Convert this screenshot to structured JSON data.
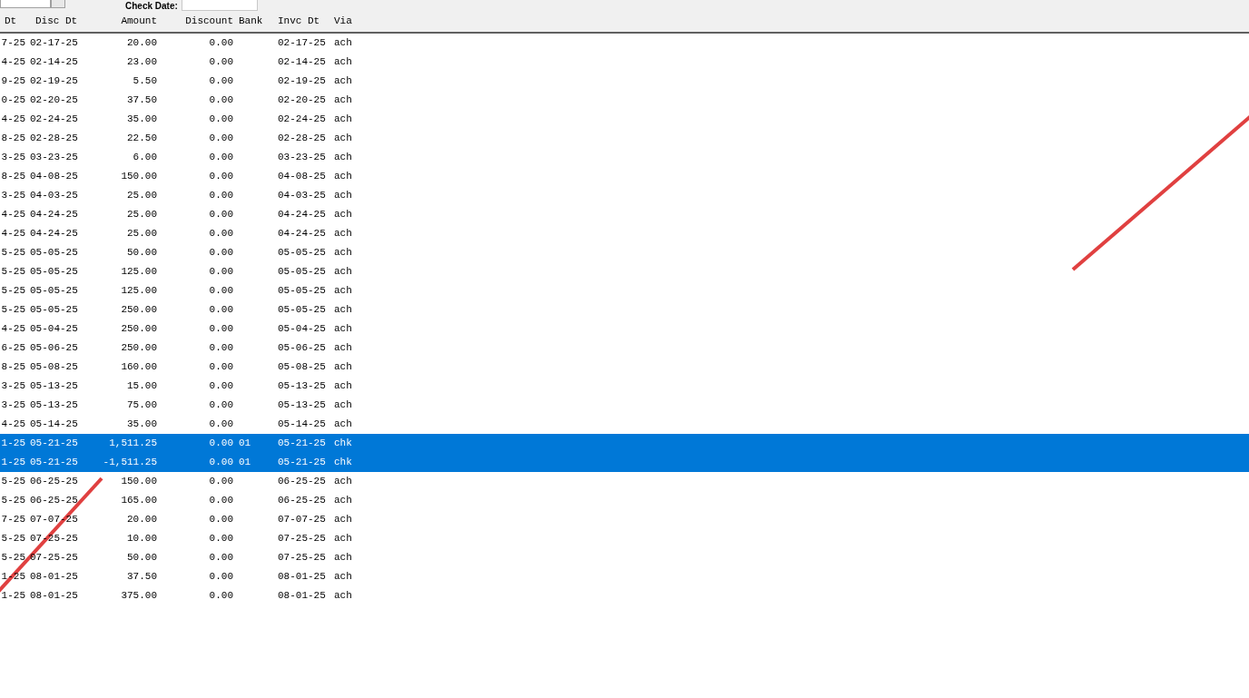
{
  "filter_bar": {
    "check_date_label": "Check Date:"
  },
  "table": {
    "columns": [
      "Dt",
      "Disc Dt",
      "Amount",
      "Discount",
      "Bank",
      "Invc Dt",
      "Via"
    ],
    "rows": [
      {
        "column_1": "7-25",
        "disc_dt": "02-17-25",
        "amount": "20.00",
        "discount": "0.00",
        "invc_dt": "02-17-25",
        "via": "ach",
        "selected": false
      },
      {
        "column_1": "4-25",
        "disc_dt": "02-14-25",
        "amount": "23.00",
        "discount": "0.00",
        "invc_dt": "02-14-25",
        "via": "ach",
        "selected": false
      },
      {
        "column_1": "9-25",
        "disc_dt": "02-19-25",
        "amount": "5.50",
        "discount": "0.00",
        "invc_dt": "02-19-25",
        "via": "ach",
        "selected": false
      },
      {
        "column_1": "0-25",
        "disc_dt": "02-20-25",
        "amount": "37.50",
        "discount": "0.00",
        "invc_dt": "02-20-25",
        "via": "ach",
        "selected": false
      },
      {
        "column_1": "4-25",
        "disc_dt": "02-24-25",
        "amount": "35.00",
        "discount": "0.00",
        "invc_dt": "02-24-25",
        "via": "ach",
        "selected": false
      },
      {
        "column_1": "8-25",
        "disc_dt": "02-28-25",
        "amount": "22.50",
        "discount": "0.00",
        "invc_dt": "02-28-25",
        "via": "ach",
        "selected": false
      },
      {
        "column_1": "3-25",
        "disc_dt": "03-23-25",
        "amount": "6.00",
        "discount": "0.00",
        "invc_dt": "03-23-25",
        "via": "ach",
        "selected": false
      },
      {
        "column_1": "8-25",
        "disc_dt": "04-08-25",
        "amount": "150.00",
        "discount": "0.00",
        "invc_dt": "04-08-25",
        "via": "ach",
        "selected": false
      },
      {
        "column_1": "3-25",
        "disc_dt": "04-03-25",
        "amount": "25.00",
        "discount": "0.00",
        "invc_dt": "04-03-25",
        "via": "ach",
        "selected": false
      },
      {
        "column_1": "4-25",
        "disc_dt": "04-24-25",
        "amount": "25.00",
        "discount": "0.00",
        "invc_dt": "04-24-25",
        "via": "ach",
        "selected": false
      },
      {
        "column_1": "4-25",
        "disc_dt": "04-24-25",
        "amount": "25.00",
        "discount": "0.00",
        "invc_dt": "04-24-25",
        "via": "ach",
        "selected": false
      },
      {
        "column_1": "5-25",
        "disc_dt": "05-05-25",
        "amount": "50.00",
        "discount": "0.00",
        "invc_dt": "05-05-25",
        "via": "ach",
        "selected": false
      },
      {
        "column_1": "5-25",
        "disc_dt": "05-05-25",
        "amount": "125.00",
        "discount": "0.00",
        "invc_dt": "05-05-25",
        "via": "ach",
        "selected": false
      },
      {
        "column_1": "5-25",
        "disc_dt": "05-05-25",
        "amount": "125.00",
        "discount": "0.00",
        "invc_dt": "05-05-25",
        "via": "ach",
        "selected": false
      },
      {
        "column_1": "5-25",
        "disc_dt": "05-05-25",
        "amount": "250.00",
        "discount": "0.00",
        "invc_dt": "05-05-25",
        "via": "ach",
        "selected": false
      },
      {
        "column_1": "4-25",
        "disc_dt": "05-04-25",
        "amount": "250.00",
        "discount": "0.00",
        "invc_dt": "05-04-25",
        "via": "ach",
        "selected": false
      },
      {
        "column_1": "6-25",
        "disc_dt": "05-06-25",
        "amount": "250.00",
        "discount": "0.00",
        "invc_dt": "05-06-25",
        "via": "ach",
        "selected": false
      },
      {
        "column_1": "8-25",
        "disc_dt": "05-08-25",
        "amount": "160.00",
        "discount": "0.00",
        "invc_dt": "05-08-25",
        "via": "ach",
        "selected": false
      },
      {
        "column_1": "3-25",
        "disc_dt": "05-13-25",
        "amount": "15.00",
        "discount": "0.00",
        "invc_dt": "05-13-25",
        "via": "ach",
        "selected": false
      },
      {
        "column_1": "3-25",
        "disc_dt": "05-13-25",
        "amount": "75.00",
        "discount": "0.00",
        "invc_dt": "05-13-25",
        "via": "ach",
        "selected": false
      },
      {
        "column_1": "4-25",
        "disc_dt": "05-14-25",
        "amount": "35.00",
        "discount": "0.00",
        "invc_dt": "05-14-25",
        "via": "ach",
        "selected": false
      },
      {
        "column_1": "1-25",
        "disc_dt": "05-21-25",
        "amount": "1,511.25",
        "discount": "0.00",
        "bank": "01",
        "invc_dt": "05-21-25",
        "via": "chk",
        "selected": true
      },
      {
        "column_1": "1-25",
        "disc_dt": "05-21-25",
        "amount": "-1,511.25",
        "discount": "0.00",
        "bank": "01",
        "invc_dt": "05-21-25",
        "via": "chk",
        "selected": true
      },
      {
        "column_1": "5-25",
        "disc_dt": "06-25-25",
        "amount": "150.00",
        "discount": "0.00",
        "invc_dt": "06-25-25",
        "via": "ach",
        "selected": false
      },
      {
        "column_1": "5-25",
        "disc_dt": "06-25-25",
        "amount": "165.00",
        "discount": "0.00",
        "invc_dt": "06-25-25",
        "via": "ach",
        "selected": false
      },
      {
        "column_1": "7-25",
        "disc_dt": "07-07-25",
        "amount": "20.00",
        "discount": "0.00",
        "invc_dt": "07-07-25",
        "via": "ach",
        "selected": false
      },
      {
        "column_1": "5-25",
        "disc_dt": "07-25-25",
        "amount": "10.00",
        "discount": "0.00",
        "invc_dt": "07-25-25",
        "via": "ach",
        "selected": false
      },
      {
        "column_1": "5-25",
        "disc_dt": "07-25-25",
        "amount": "50.00",
        "discount": "0.00",
        "invc_dt": "07-25-25",
        "via": "ach",
        "selected": false
      },
      {
        "column_1": "1-25",
        "disc_dt": "08-01-25",
        "amount": "37.50",
        "discount": "0.00",
        "invc_dt": "08-01-25",
        "via": "ach",
        "selected": false
      },
      {
        "column_1": "1-25",
        "disc_dt": "08-01-25",
        "amount": "375.00",
        "discount": "0.00",
        "invc_dt": "08-01-25",
        "via": "ach",
        "selected": false
      }
    ]
  }
}
